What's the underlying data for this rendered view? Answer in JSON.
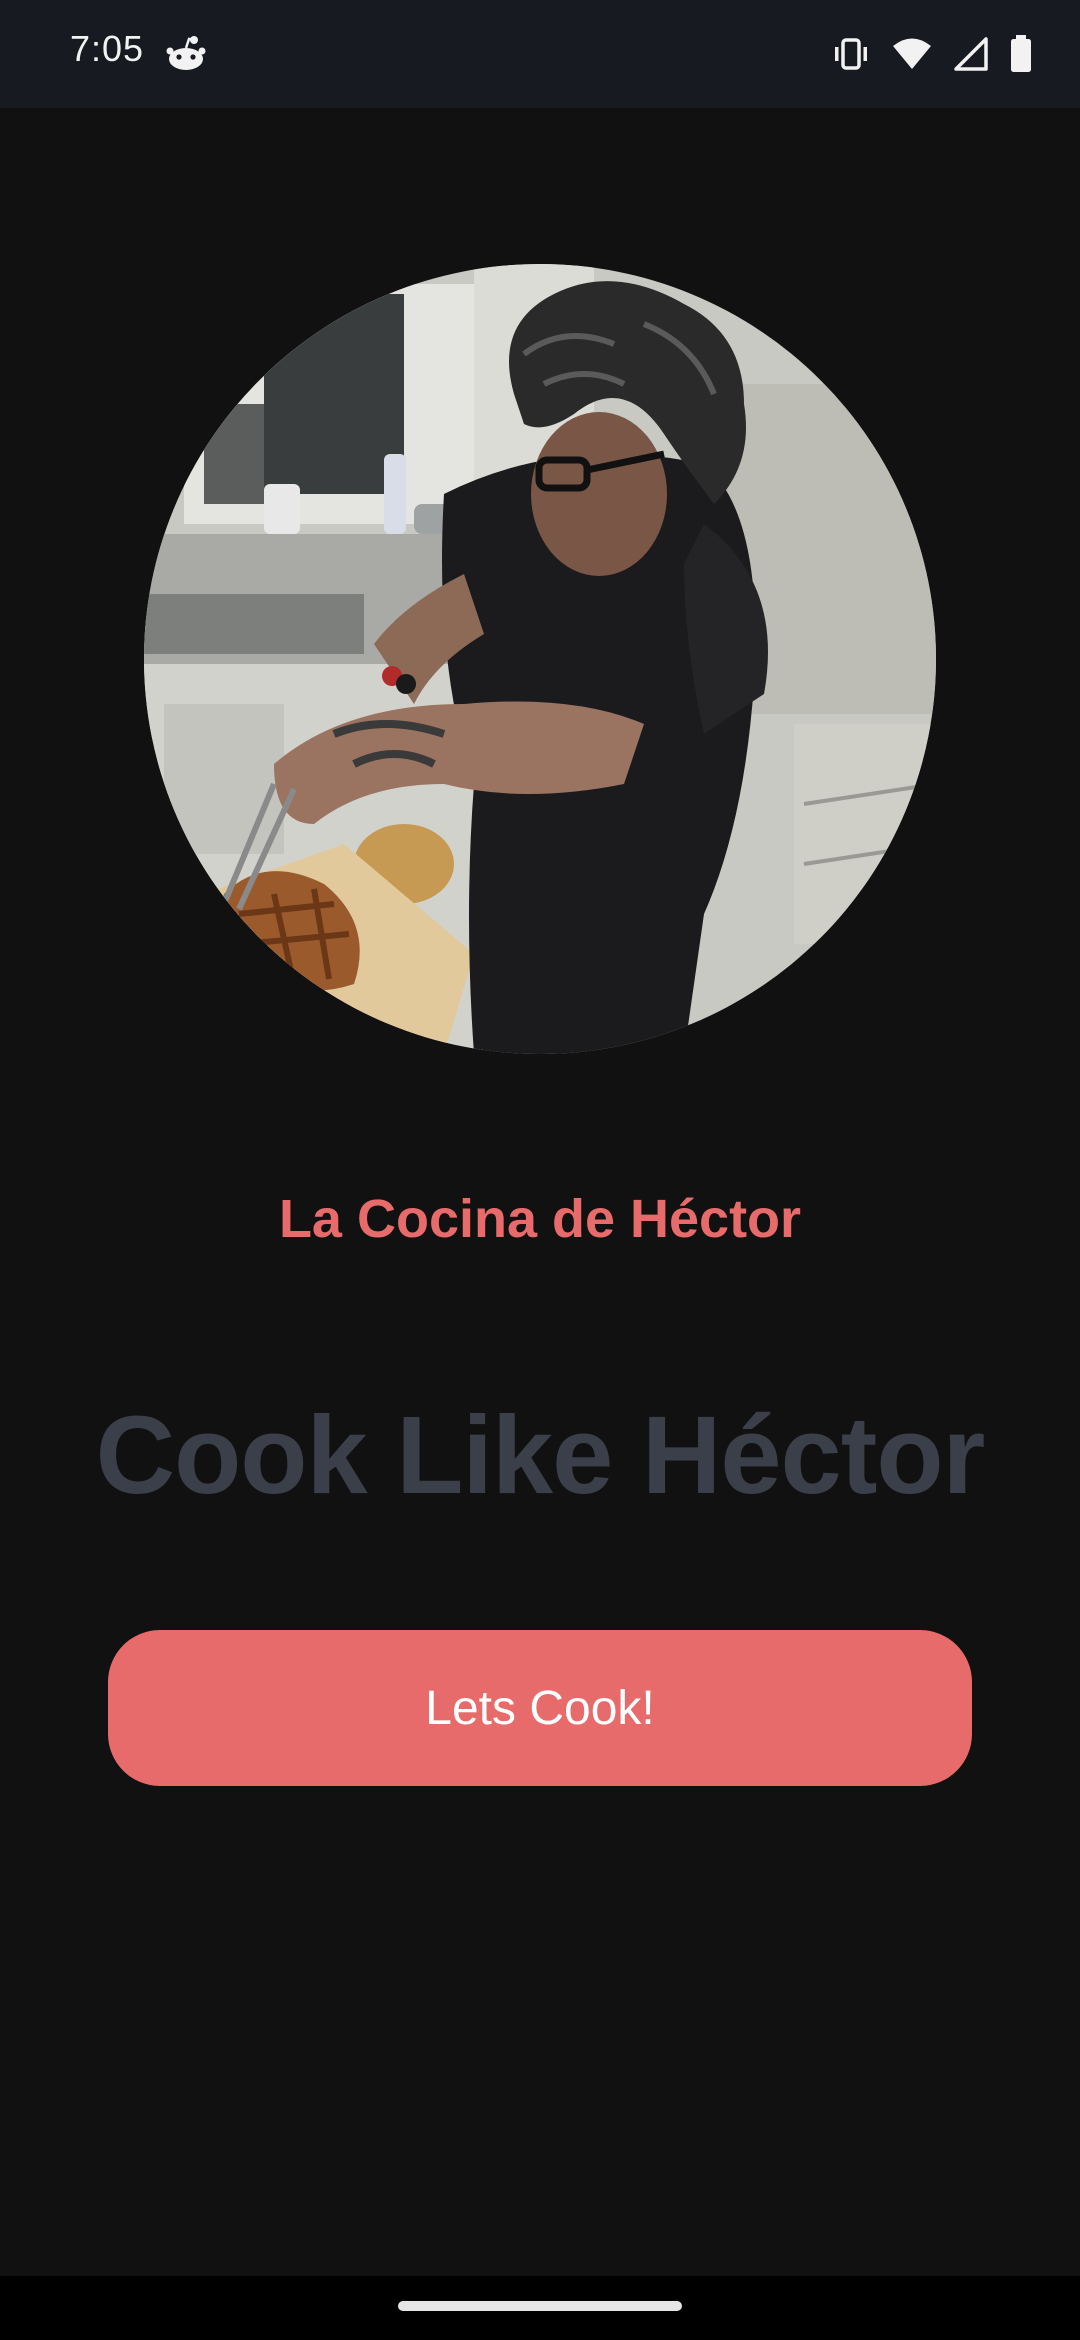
{
  "status_bar": {
    "time": "7:05",
    "app_icon": "reddit-icon",
    "icons": [
      "vibrate-icon",
      "wifi-icon",
      "cell-signal-icon",
      "battery-icon"
    ]
  },
  "hero": {
    "image": "photo of a man cooking in a kitchen"
  },
  "brand": {
    "title": "La Cocina de Héctor"
  },
  "headline": {
    "text": "Cook Like Héctor"
  },
  "cta": {
    "label": "Lets Cook!"
  },
  "colors": {
    "background": "#121112",
    "status_bar": "#181a21",
    "accent": "#e86b6b",
    "headline": "#3a3f4a",
    "button_text": "#ffffff"
  }
}
